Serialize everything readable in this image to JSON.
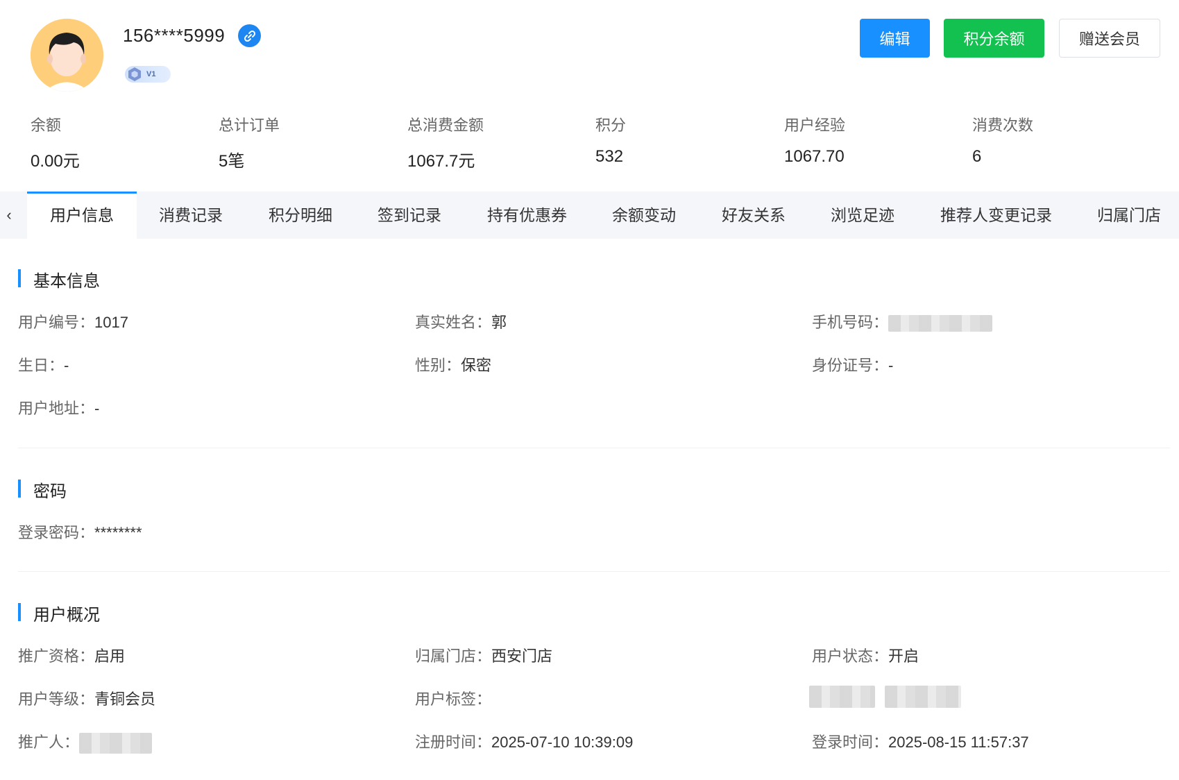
{
  "header": {
    "username": "156****5999",
    "level": "V1",
    "buttons": {
      "edit": "编辑",
      "points_balance": "积分余额",
      "gift_member": "赠送会员"
    }
  },
  "stats": [
    {
      "label": "余额",
      "value": "0.00元"
    },
    {
      "label": "总计订单",
      "value": "5笔"
    },
    {
      "label": "总消费金额",
      "value": "1067.7元"
    },
    {
      "label": "积分",
      "value": "532"
    },
    {
      "label": "用户经验",
      "value": "1067.70"
    },
    {
      "label": "消费次数",
      "value": "6"
    }
  ],
  "tabs": [
    "用户信息",
    "消费记录",
    "积分明细",
    "签到记录",
    "持有优惠券",
    "余额变动",
    "好友关系",
    "浏览足迹",
    "推荐人变更记录",
    "归属门店"
  ],
  "active_tab": "用户信息",
  "basic_info": {
    "title": "基本信息",
    "user_id_label": "用户编号：",
    "user_id": "1017",
    "real_name_label": "真实姓名：",
    "real_name": "郭",
    "phone_label": "手机号码：",
    "birthday_label": "生日：",
    "birthday": "-",
    "gender_label": "性别：",
    "gender": "保密",
    "id_card_label": "身份证号：",
    "id_card": "-",
    "address_label": "用户地址：",
    "address": "-"
  },
  "password": {
    "title": "密码",
    "login_password_label": "登录密码：",
    "login_password": "********"
  },
  "overview": {
    "title": "用户概况",
    "promo_label": "推广资格：",
    "promo": "启用",
    "store_label": "归属门店：",
    "store": "西安门店",
    "status_label": "用户状态：",
    "status": "开启",
    "level_label": "用户等级：",
    "level": "青铜会员",
    "tags_label": "用户标签：",
    "promoter_label": "推广人：",
    "register_label": "注册时间：",
    "register_time": "2025-07-10 10:39:09",
    "login_label": "登录时间：",
    "login_time": "2025-08-15 11:57:37"
  },
  "colors": {
    "primary": "#1890ff",
    "success": "#13c150",
    "avatar_bg": "#ffce7a"
  }
}
